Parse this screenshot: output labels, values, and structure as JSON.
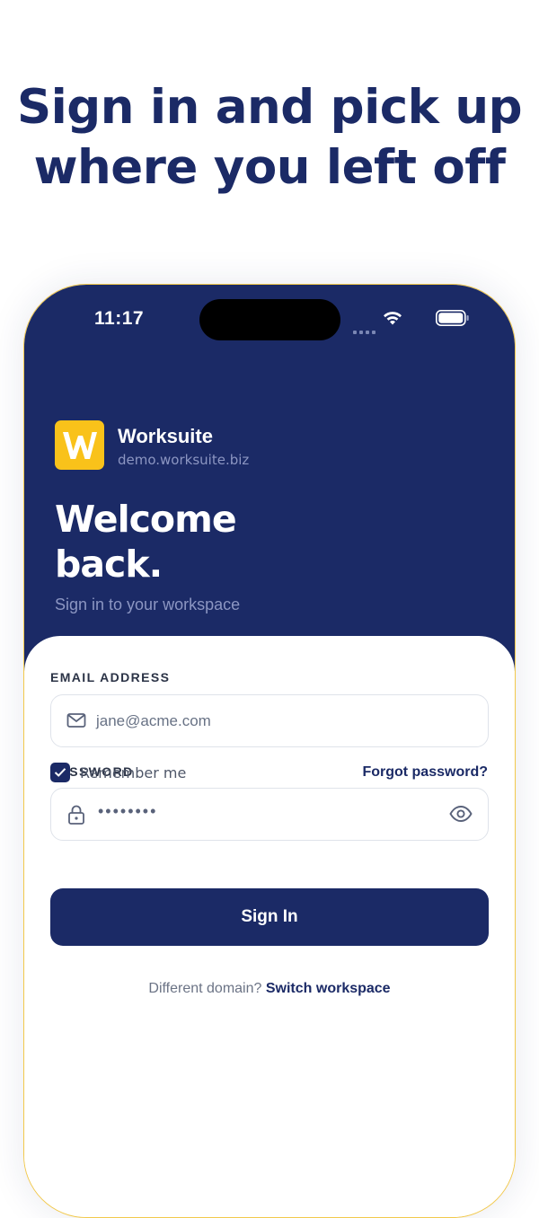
{
  "headline": {
    "line1": "Sign in and pick up",
    "line2": "where you left off"
  },
  "status_bar": {
    "time": "11:17"
  },
  "brand": {
    "name": "Worksuite",
    "domain": "demo.worksuite.biz",
    "logo_letter": "W",
    "logo_color": "#F9C21A"
  },
  "welcome": {
    "line1": "Welcome",
    "line2": "back.",
    "subtitle": "Sign in to your workspace"
  },
  "form": {
    "email_label": "EMAIL ADDRESS",
    "email_value": "jane@acme.com",
    "password_label": "PASSWORD",
    "password_mask": "••••••••",
    "remember_label": "Remember me",
    "remember_checked": true,
    "forgot_label": "Forgot password?",
    "signin_label": "Sign In"
  },
  "footer": {
    "prompt": "Different domain?",
    "link": "Switch workspace"
  },
  "icons": {
    "email": "envelope-icon",
    "password": "lock-icon",
    "reveal": "eye-icon",
    "check": "checkmark-icon",
    "wifi": "wifi-icon",
    "battery": "battery-icon"
  },
  "colors": {
    "primary": "#1B2A66",
    "accent": "#F9C21A",
    "background": "#FFFFFF"
  }
}
